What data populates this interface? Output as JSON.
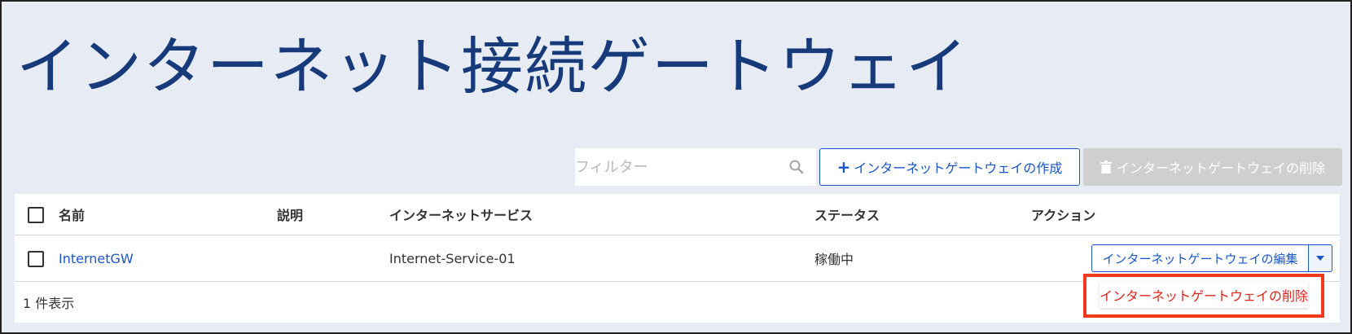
{
  "page": {
    "title": "インターネット接続ゲートウェイ"
  },
  "toolbar": {
    "filter_placeholder": "フィルター",
    "create_label": "インターネットゲートウェイの作成",
    "delete_label": "インターネットゲートウェイの削除"
  },
  "table": {
    "headers": {
      "name": "名前",
      "description": "説明",
      "internet_service": "インターネットサービス",
      "status": "ステータス",
      "action": "アクション"
    },
    "rows": [
      {
        "name": "InternetGW",
        "description": "",
        "internet_service": "Internet-Service-01",
        "status": "稼働中",
        "action_label": "インターネットゲートウェイの編集"
      }
    ],
    "footer": "1 件表示"
  },
  "dropdown": {
    "items": [
      {
        "label": "インターネットゲートウェイの削除"
      }
    ]
  },
  "colors": {
    "accent": "#1a56c9",
    "title": "#173a7a",
    "danger": "#e0241b",
    "highlight": "#f03a1e",
    "background": "#e6ebf4"
  }
}
